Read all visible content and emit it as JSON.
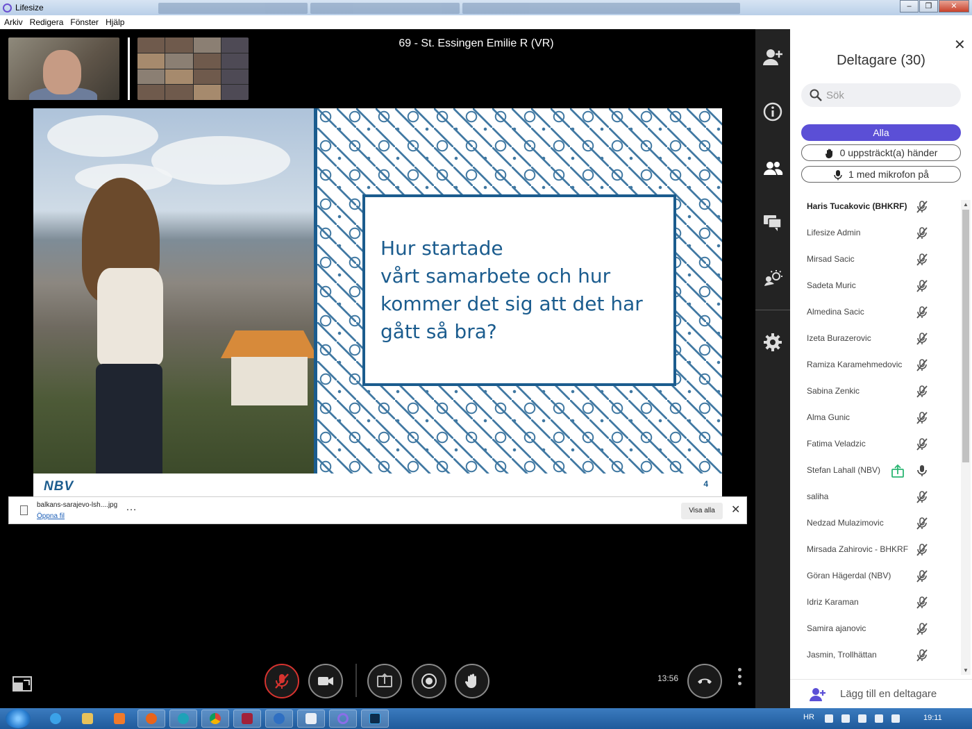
{
  "window": {
    "title": "Lifesize",
    "controls": [
      "–",
      "❐",
      "✕"
    ]
  },
  "menu": [
    "Arkiv",
    "Redigera",
    "Fönster",
    "Hjälp"
  ],
  "call": {
    "title": "69 - St. Essingen Emilie R (VR)",
    "time": "13:56"
  },
  "slide": {
    "text": "Hur startade\nvårt samarbete och hur\nkommer det sig att det har\ngått så bra?",
    "logo": "NBV",
    "page_number": "4"
  },
  "download": {
    "filename": "balkans-sarajevo-lsh....jpg",
    "open_label": "Öppna fil",
    "more": "…",
    "show_all": "Visa alla",
    "close": "✕"
  },
  "panel": {
    "close": "✕",
    "title": "Deltagare (30)",
    "search_placeholder": "Sök",
    "filter_all": "Alla",
    "filter_hands": "0 uppsträckt(a) händer",
    "filter_mic": "1 med mikrofon på",
    "add_participant": "Lägg till en deltagare"
  },
  "participants": [
    {
      "name": "Haris Tucakovic (BHKRF)",
      "bold": true,
      "mic": "muted"
    },
    {
      "name": "Lifesize Admin",
      "mic": "muted"
    },
    {
      "name": "Mirsad Sacic",
      "mic": "muted"
    },
    {
      "name": "Sadeta Muric",
      "mic": "muted"
    },
    {
      "name": "Almedina Sacic",
      "mic": "muted"
    },
    {
      "name": "Izeta Burazerovic",
      "mic": "muted"
    },
    {
      "name": "Ramiza Karamehmedovic",
      "mic": "muted"
    },
    {
      "name": "Sabina Zenkic",
      "mic": "muted"
    },
    {
      "name": "Alma Gunic",
      "mic": "muted"
    },
    {
      "name": "Fatima Veladzic",
      "mic": "muted"
    },
    {
      "name": "Stefan Lahall (NBV)",
      "mic": "on",
      "sharing": true
    },
    {
      "name": "saliha",
      "mic": "muted"
    },
    {
      "name": "Nedzad Mulazimovic",
      "mic": "muted"
    },
    {
      "name": "Mirsada Zahirovic - BHKRF",
      "mic": "muted"
    },
    {
      "name": "Göran Hägerdal (NBV)",
      "mic": "muted"
    },
    {
      "name": "Idriz Karaman",
      "mic": "muted"
    },
    {
      "name": "Samira ajanovic",
      "mic": "muted"
    },
    {
      "name": "Jasmin, Trollhättan",
      "mic": "muted"
    }
  ],
  "taskbar": {
    "language": "HR",
    "time": "19:11"
  },
  "colors": {
    "accent": "#5b4fd6",
    "slide_blue": "#1b5c8e",
    "mute_red": "#d6332f",
    "share_green": "#2bb673"
  }
}
